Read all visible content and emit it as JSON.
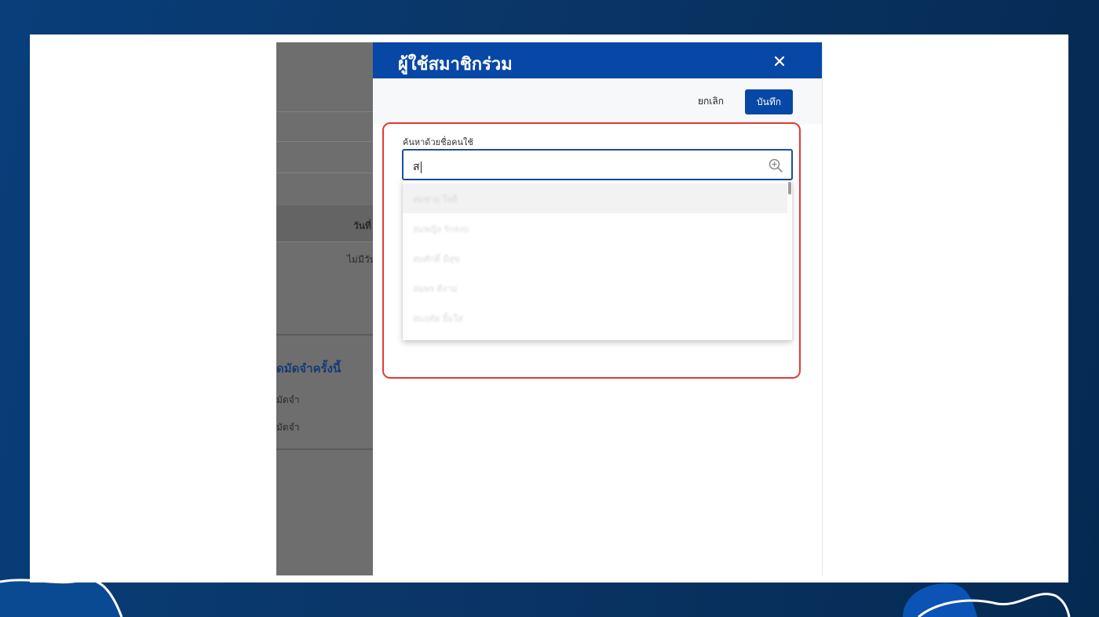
{
  "drawer": {
    "title": "ผู้ใช้สมาชิกร่วม",
    "cancel_label": "ยกเลิก",
    "save_label": "บันทึก"
  },
  "search": {
    "label": "ค้นหาด้วยชื่อคนใช้",
    "value": "ส"
  },
  "suggestions": [
    {
      "label": "สมชาย ใจดี"
    },
    {
      "label": "สมหญิง รักสงบ"
    },
    {
      "label": "สมศักดิ์ มีสุข"
    },
    {
      "label": "สมพร ดีงาม"
    },
    {
      "label": "สมฤทัย ยิ้มใส"
    }
  ],
  "background_page": {
    "column_header": "วันที่",
    "empty_text": "ไม่มีวัน",
    "section_heading": "ดมัดจำครั้งนี้",
    "row1": "มัดจำ",
    "row2": "มัดจำ"
  },
  "colors": {
    "primary": "#0747a6",
    "highlight": "#e53935",
    "backdrop_gradient_start": "#083e7a",
    "backdrop_gradient_end": "#052a52"
  }
}
